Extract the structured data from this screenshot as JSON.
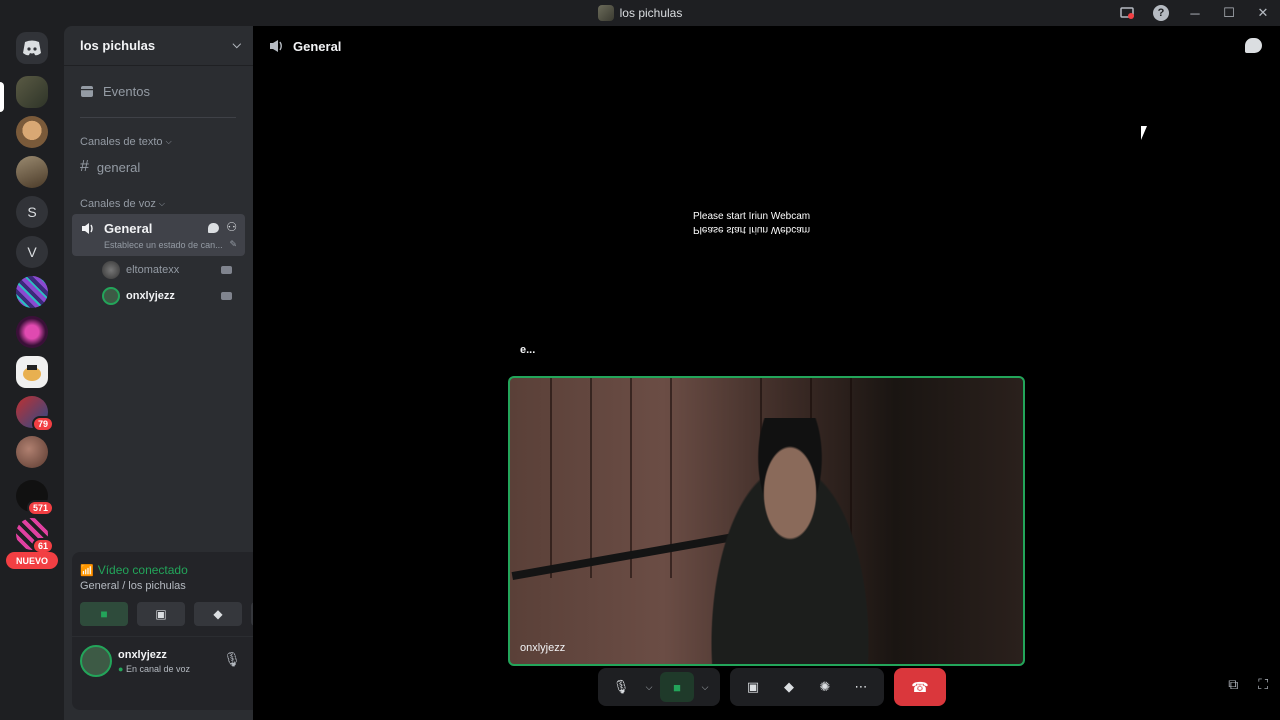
{
  "window": {
    "title": "los pichulas"
  },
  "rail": {
    "badges": [
      "79",
      "571",
      "61"
    ],
    "letters": [
      "S",
      "V"
    ],
    "new_label": "NUEVO"
  },
  "sidebar": {
    "guild_name": "los pichulas",
    "events_label": "Eventos",
    "text_category": "Canales de texto",
    "text_channel": "general",
    "voice_category": "Canales de voz",
    "voice_channel": "General",
    "voice_status_placeholder": "Establece un estado de can...",
    "voice_users": [
      "eltomatexx",
      "onxlyjezz"
    ]
  },
  "voice_panel": {
    "title": "Vídeo conectado",
    "subtitle": "General / los pichulas"
  },
  "user": {
    "name": "onxlyjezz",
    "status": "En canal de voz"
  },
  "stage": {
    "channel_name": "General",
    "overlay_line1": "Please start Iriun Webcam",
    "overlay_line2": "Please start Iriun Webcam",
    "typing_name": "e...",
    "tile_label": "onxlyjezz"
  },
  "colors": {
    "accent_green": "#23a55a",
    "danger_red": "#da373c",
    "sidebar_bg": "#2b2d31",
    "rail_bg": "#1e1f22"
  }
}
